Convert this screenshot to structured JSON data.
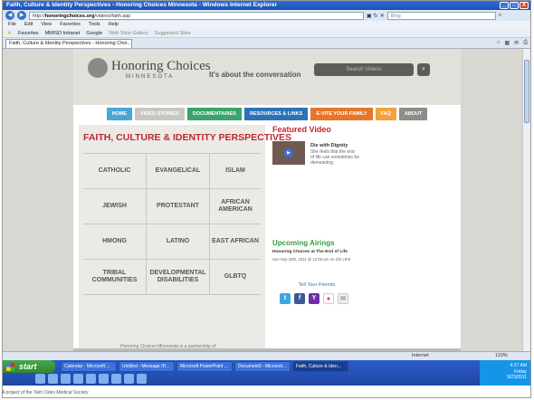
{
  "window": {
    "title": "Faith, Culture & Identity Perspectives - Honoring Choices Minnesota - Windows Internet Explorer",
    "minimize": "_",
    "maximize": "□",
    "close": "X"
  },
  "address": {
    "url_prefix": "http://",
    "url_domain": "honoringchoices.org",
    "url_path": "/videos/faith.asp",
    "search_placeholder": "Bing"
  },
  "menu": [
    "File",
    "Edit",
    "View",
    "Favorites",
    "Tools",
    "Help"
  ],
  "favorites": {
    "label": "Favorites",
    "items": [
      "MMISO Intranet",
      "Google",
      "Web Slice Gallery",
      "Suggested Sites"
    ]
  },
  "tab": {
    "title": "Faith, Culture & Identity Perspectives - Honoring Choi..."
  },
  "site": {
    "logo_name": "Honoring Choices",
    "logo_sub": "MINNESOTA",
    "tagline": "It's about the conversation",
    "search_placeholder": "Search Videos",
    "nav": [
      {
        "label": "HOME",
        "color": "#4aa8d8"
      },
      {
        "label": "VIDEO STORIES",
        "color": "#c9c7c2"
      },
      {
        "label": "DOCUMENTARIES",
        "color": "#3ba36b"
      },
      {
        "label": "RESOURCES & LINKS",
        "color": "#2a73b8"
      },
      {
        "label": "E-VITE YOUR FAMILY",
        "color": "#e8762a"
      },
      {
        "label": "FAQ",
        "color": "#f2a23b"
      },
      {
        "label": "ABOUT",
        "color": "#8f8b86"
      }
    ],
    "section_title": "FAITH, CULTURE & IDENTITY PERSPECTIVES",
    "perspectives": [
      "CATHOLIC",
      "EVANGELICAL",
      "ISLAM",
      "JEWISH",
      "PROTESTANT",
      "AFRICAN AMERICAN",
      "HMONG",
      "LATINO",
      "EAST AFRICAN",
      "TRIBAL COMMUNITIES",
      "DEVELOPMENTAL DISABILITIES",
      "GLBTQ"
    ],
    "featured": {
      "heading": "Featured Video",
      "title": "Die with Dignity",
      "description": "She feels that the end of life can sometimes be demeaning."
    },
    "airings": {
      "heading": "Upcoming Airings",
      "show": "Honoring Choices at The End of Life",
      "date": "Sun Sep 25th, 2011 @ 12:00 pm on @6 LIFE"
    },
    "friends": "Tell Your Friends",
    "footer": "Honoring Choices Minnesota is a partnership of"
  },
  "statusbar": {
    "zone": "Internet",
    "zoom": "110%"
  },
  "taskbar": {
    "start": "start",
    "tasks": [
      "Calendar - Microsoft ...",
      "Untitled - Message (H...",
      "Microsoft PowerPoint ...",
      "Document3 - Microsof...",
      "Faith, Culture & Iden..."
    ],
    "clock": "4:27 AM",
    "day": "Friday",
    "date": "9/23/2011"
  },
  "caption": "A project of the Twin Cities Medical Society"
}
